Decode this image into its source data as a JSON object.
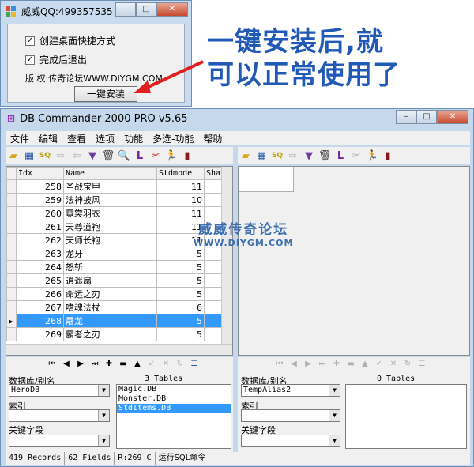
{
  "installer": {
    "title": "威威QQ:499357535",
    "option1": "创建桌面快捷方式",
    "option2": "完成后退出",
    "copyright": "版  权:传奇论坛WWW.DIYGM.COM",
    "install_button": "一键安装"
  },
  "banner": {
    "line1": "一键安装后,就",
    "line2": "可以正常使用了"
  },
  "db": {
    "title": "DB Commander 2000 PRO v5.65",
    "menu": [
      "文件",
      "编辑",
      "查看",
      "选项",
      "功能",
      "多选-功能",
      "帮助"
    ],
    "columns": [
      "Idx",
      "Name",
      "Stdmode",
      "Sha"
    ],
    "rows": [
      {
        "idx": "258",
        "name": "圣战宝甲",
        "std": "11"
      },
      {
        "idx": "259",
        "name": "法神披风",
        "std": "10"
      },
      {
        "idx": "260",
        "name": "霓裳羽衣",
        "std": "11"
      },
      {
        "idx": "261",
        "name": "天尊道袍",
        "std": "11"
      },
      {
        "idx": "262",
        "name": "天师长袍",
        "std": "11"
      },
      {
        "idx": "263",
        "name": "龙牙",
        "std": "5"
      },
      {
        "idx": "264",
        "name": "怒斩",
        "std": "5"
      },
      {
        "idx": "265",
        "name": "逍遥扇",
        "std": "5"
      },
      {
        "idx": "266",
        "name": "命运之刃",
        "std": "5"
      },
      {
        "idx": "267",
        "name": "嗜魂法杖",
        "std": "6"
      },
      {
        "idx": "268",
        "name": "屠龙",
        "std": "5"
      },
      {
        "idx": "269",
        "name": "霸者之刃",
        "std": "5"
      }
    ],
    "watermark1": "威威传奇论坛",
    "watermark2": "WWW.DIYGM.COM",
    "left_panel": {
      "db_label": "数据库/别名",
      "db_value": "HeroDB",
      "tables_count": "3 Tables",
      "tables": [
        "Magic.DB",
        "Monster.DB",
        "StdItems.DB"
      ],
      "index_label": "索引",
      "key_label": "关键字段"
    },
    "right_panel": {
      "db_label": "数据库/别名",
      "db_value": "TempAlias2",
      "tables_count": "0 Tables",
      "index_label": "索引",
      "key_label": "关键字段"
    },
    "status": {
      "records": "419 Records",
      "fields": "62 Fields",
      "cursor": "R:269 C",
      "sql": "运行SQL命令"
    }
  }
}
